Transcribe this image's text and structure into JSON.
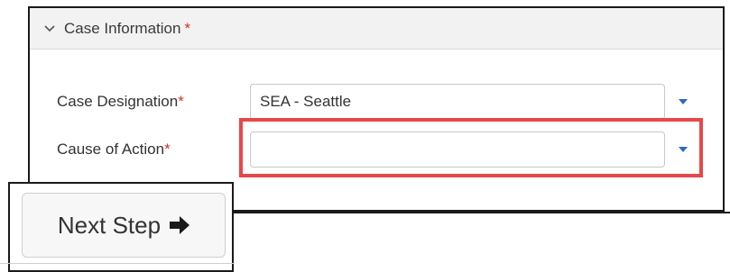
{
  "section": {
    "title": "Case Information",
    "required_marker": "*"
  },
  "fields": [
    {
      "label": "Case Designation",
      "required_marker": "*",
      "value": "SEA - Seattle",
      "placeholder": ""
    },
    {
      "label": "Cause of Action",
      "required_marker": "*",
      "value": "",
      "placeholder": ""
    }
  ],
  "next_step": {
    "label": "Next Step"
  },
  "icons": {
    "section_toggle": "chevron-down-icon",
    "dropdown": "caret-down-icon",
    "next": "arrow-right-icon"
  },
  "colors": {
    "required": "#d93025",
    "caret": "#2a6db5",
    "highlight": "#e8474a",
    "header_bg": "#f2f2f2"
  }
}
